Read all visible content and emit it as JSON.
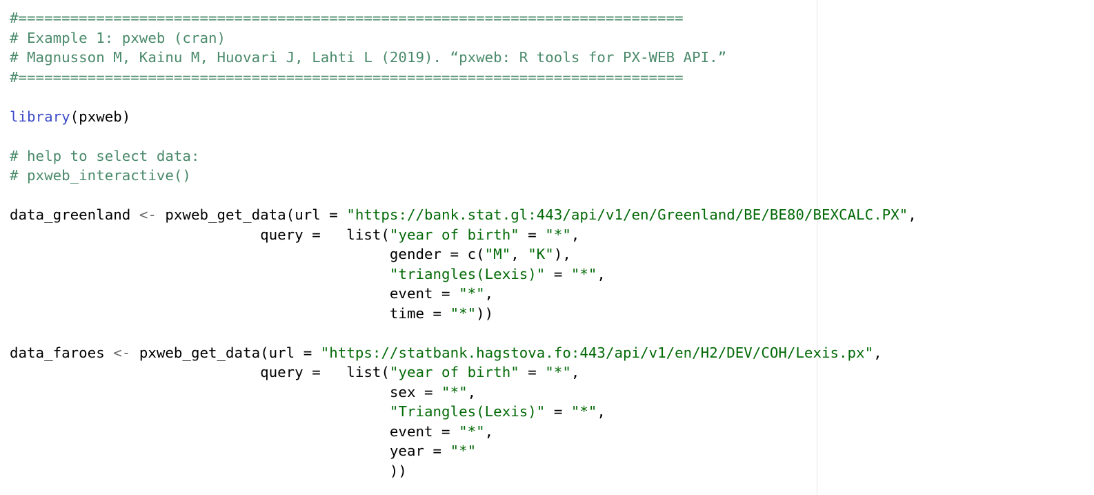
{
  "editor": {
    "lines": [
      [
        {
          "t": "comment",
          "s": "#============================================================================="
        }
      ],
      [
        {
          "t": "comment",
          "s": "# Example 1: pxweb (cran)"
        }
      ],
      [
        {
          "t": "comment",
          "s": "# Magnusson M, Kainu M, Huovari J, Lahti L (2019). “pxweb: R tools for PX-WEB API.”"
        }
      ],
      [
        {
          "t": "comment",
          "s": "#============================================================================="
        }
      ],
      [],
      [
        {
          "t": "func",
          "s": "library"
        },
        {
          "t": "plain",
          "s": "(pxweb)"
        }
      ],
      [],
      [
        {
          "t": "comment",
          "s": "# help to select data:"
        }
      ],
      [
        {
          "t": "comment",
          "s": "# pxweb_interactive()"
        }
      ],
      [],
      [
        {
          "t": "plain",
          "s": "data_greenland "
        },
        {
          "t": "op",
          "s": "<-"
        },
        {
          "t": "plain",
          "s": " pxweb_get_data(url = "
        },
        {
          "t": "string",
          "s": "\"https://bank.stat.gl:443/api/v1/en/Greenland/BE/BE80/BEXCALC.PX\""
        },
        {
          "t": "plain",
          "s": ","
        }
      ],
      [
        {
          "t": "plain",
          "s": "                             query =   list("
        },
        {
          "t": "string",
          "s": "\"year of birth\""
        },
        {
          "t": "plain",
          "s": " = "
        },
        {
          "t": "string",
          "s": "\"*\""
        },
        {
          "t": "plain",
          "s": ","
        }
      ],
      [
        {
          "t": "plain",
          "s": "                                            gender = c("
        },
        {
          "t": "string",
          "s": "\"M\""
        },
        {
          "t": "plain",
          "s": ", "
        },
        {
          "t": "string",
          "s": "\"K\""
        },
        {
          "t": "plain",
          "s": "),"
        }
      ],
      [
        {
          "t": "plain",
          "s": "                                            "
        },
        {
          "t": "string",
          "s": "\"triangles(Lexis)\""
        },
        {
          "t": "plain",
          "s": " = "
        },
        {
          "t": "string",
          "s": "\"*\""
        },
        {
          "t": "plain",
          "s": ","
        }
      ],
      [
        {
          "t": "plain",
          "s": "                                            event = "
        },
        {
          "t": "string",
          "s": "\"*\""
        },
        {
          "t": "plain",
          "s": ","
        }
      ],
      [
        {
          "t": "plain",
          "s": "                                            time = "
        },
        {
          "t": "string",
          "s": "\"*\""
        },
        {
          "t": "plain",
          "s": "))"
        }
      ],
      [],
      [
        {
          "t": "plain",
          "s": "data_faroes "
        },
        {
          "t": "op",
          "s": "<-"
        },
        {
          "t": "plain",
          "s": " pxweb_get_data(url = "
        },
        {
          "t": "string",
          "s": "\"https://statbank.hagstova.fo:443/api/v1/en/H2/DEV/COH/Lexis.px\""
        },
        {
          "t": "plain",
          "s": ","
        }
      ],
      [
        {
          "t": "plain",
          "s": "                             query =   list("
        },
        {
          "t": "string",
          "s": "\"year of birth\""
        },
        {
          "t": "plain",
          "s": " = "
        },
        {
          "t": "string",
          "s": "\"*\""
        },
        {
          "t": "plain",
          "s": ","
        }
      ],
      [
        {
          "t": "plain",
          "s": "                                            sex = "
        },
        {
          "t": "string",
          "s": "\"*\""
        },
        {
          "t": "plain",
          "s": ","
        }
      ],
      [
        {
          "t": "plain",
          "s": "                                            "
        },
        {
          "t": "string",
          "s": "\"Triangles(Lexis)\""
        },
        {
          "t": "plain",
          "s": " = "
        },
        {
          "t": "string",
          "s": "\"*\""
        },
        {
          "t": "plain",
          "s": ","
        }
      ],
      [
        {
          "t": "plain",
          "s": "                                            event = "
        },
        {
          "t": "string",
          "s": "\"*\""
        },
        {
          "t": "plain",
          "s": ","
        }
      ],
      [
        {
          "t": "plain",
          "s": "                                            year = "
        },
        {
          "t": "string",
          "s": "\"*\""
        }
      ],
      [
        {
          "t": "plain",
          "s": "                                            ))"
        }
      ]
    ]
  },
  "colors": {
    "background": "#ffffff",
    "comment": "#4a8a6a",
    "string": "#036a07",
    "function": "#3c4cc8",
    "operator": "#6b6b6b",
    "plain": "#000000"
  }
}
